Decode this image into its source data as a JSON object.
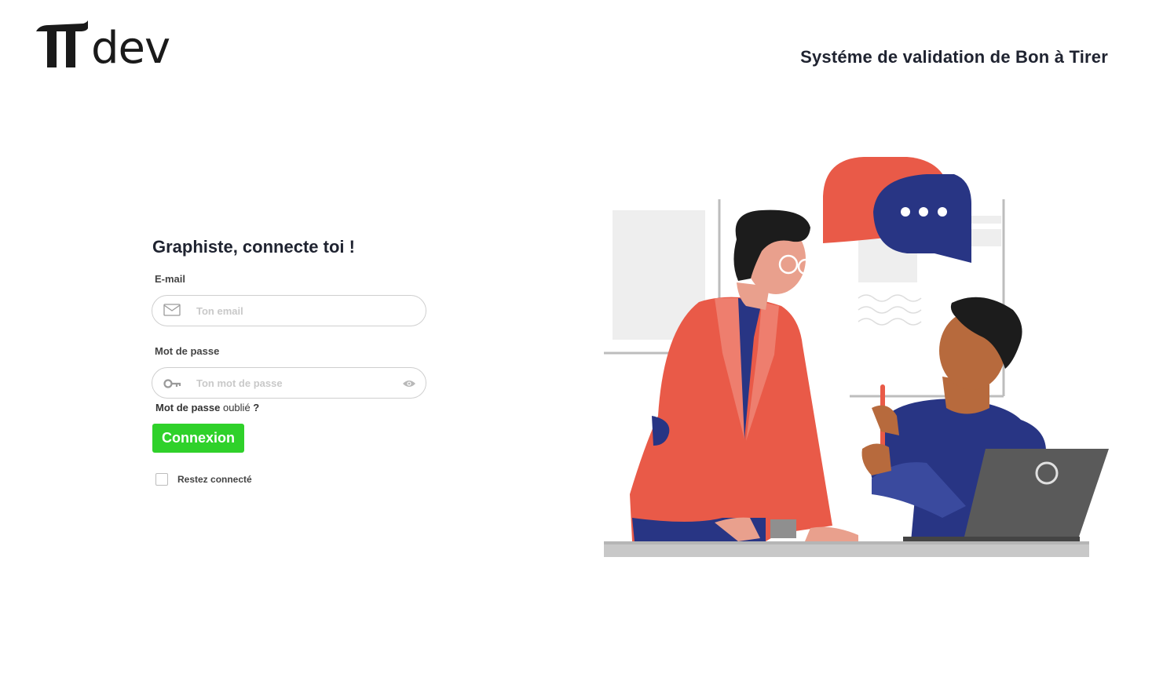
{
  "header": {
    "logo_text": "dev",
    "app_title": "Systéme de validation de Bon à Tirer"
  },
  "login": {
    "heading": "Graphiste, connecte toi !",
    "email_label": "E-mail",
    "email_placeholder": "Ton email",
    "email_value": "",
    "password_label": "Mot de passe",
    "password_placeholder": "Ton mot de passe",
    "password_value": "",
    "forgot_bold": "Mot de passe",
    "forgot_plain": " oublié ",
    "forgot_mark": "?",
    "submit_label": "Connexion",
    "remember_label": "Restez connecté",
    "remember_checked": false
  },
  "icons": {
    "email": "envelope-icon",
    "password": "key-icon",
    "reveal": "eye-icon"
  },
  "colors": {
    "primary_button": "#2fd12a",
    "accent_red": "#e95a48",
    "accent_navy": "#283584"
  }
}
